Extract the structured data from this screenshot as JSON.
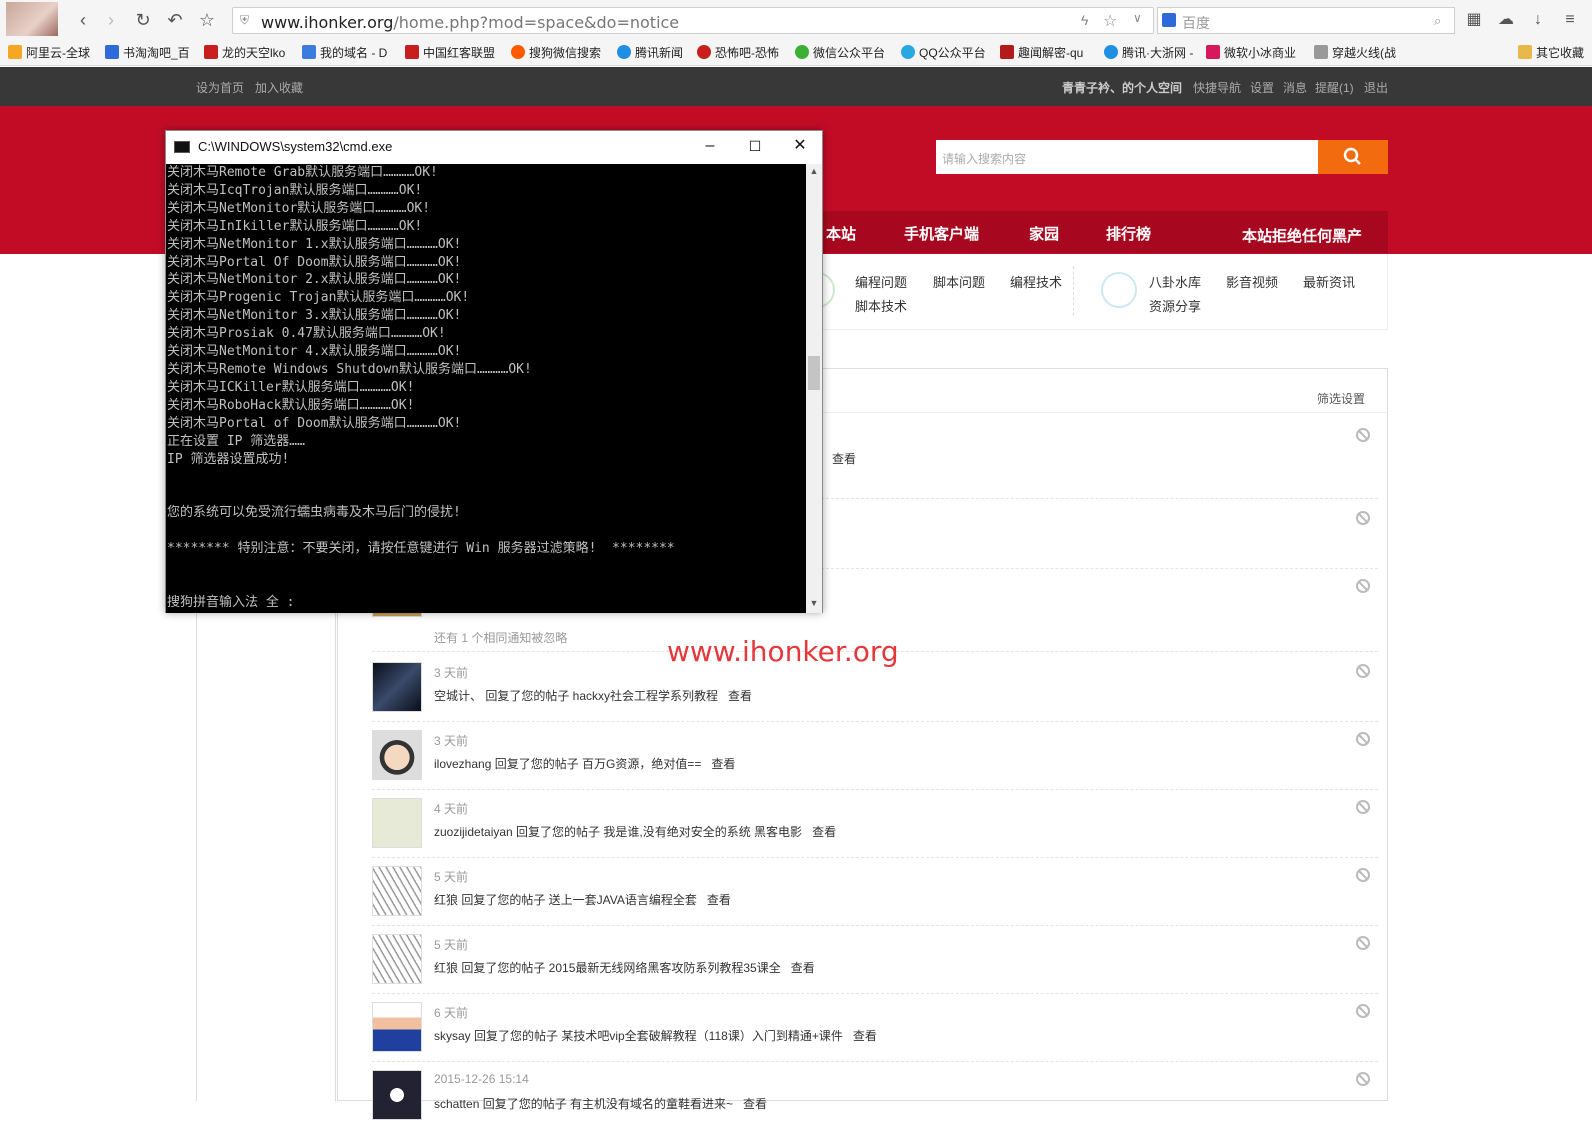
{
  "browser": {
    "url_host": "www.ihonker.org",
    "url_path": "/home.php?mod=space&do=notice",
    "search_placeholder": "百度",
    "bookmarks": [
      {
        "label": "阿里云-全球",
        "color": "#f5a623"
      },
      {
        "label": "书淘淘吧_百",
        "color": "#2f6bd8"
      },
      {
        "label": "龙的天空lko",
        "color": "#c81e1e"
      },
      {
        "label": "我的域名 - D",
        "color": "#3b7ddd"
      },
      {
        "label": "中国红客联盟",
        "color": "#c81e1e"
      },
      {
        "label": "搜狗微信搜索",
        "color": "#ff5a00"
      },
      {
        "label": "腾讯新闻",
        "color": "#1e8fe1"
      },
      {
        "label": "恐怖吧-恐怖",
        "color": "#c81e1e"
      },
      {
        "label": "微信公众平台",
        "color": "#3cb034"
      },
      {
        "label": "QQ公众平台",
        "color": "#29a7e1"
      },
      {
        "label": "趣闻解密-qu",
        "color": "#b31b1b"
      },
      {
        "label": "腾讯·大浙网 -",
        "color": "#1e8fe1"
      },
      {
        "label": "微软小冰商业",
        "color": "#d6195c"
      },
      {
        "label": "穿越火线(战",
        "color": "#999999"
      }
    ],
    "other_bookmarks": "其它收藏"
  },
  "site": {
    "top_left": [
      "设为首页",
      "加入收藏"
    ],
    "user_space": "青青子衿、的个人空间",
    "top_right": [
      "快捷导航",
      "设置",
      "消息",
      "提醒(1)",
      "退出"
    ],
    "search_placeholder": "请输入搜索内容",
    "nav": [
      "本站",
      "手机客户端",
      "家园",
      "排行榜"
    ],
    "slogan": "本站拒绝任何黑产",
    "categories_a": [
      "编程问题",
      "脚本问题",
      "编程技术",
      "脚本技术"
    ],
    "categories_b": [
      "八卦水库",
      "影音视频",
      "最新资讯",
      "资源分享"
    ],
    "filter_settings": "筛选设置",
    "watermark": "www.ihonker.org"
  },
  "notices": [
    {
      "time": "",
      "text": "",
      "view": "查看"
    },
    {
      "time": "",
      "text": "",
      "view": ""
    },
    {
      "time": "",
      "text": "还有 1 个相同通知被忽略",
      "view": ""
    },
    {
      "time": "3 天前",
      "text": "空城计、 回复了您的帖子 hackxy社会工程学系列教程",
      "view": "查看"
    },
    {
      "time": "3 天前",
      "text": "ilovezhang 回复了您的帖子 百万G资源，绝对值==",
      "view": "查看"
    },
    {
      "time": "4 天前",
      "text": "zuozijidetaiyan 回复了您的帖子 我是谁,没有绝对安全的系统 黑客电影",
      "view": "查看"
    },
    {
      "time": "5 天前",
      "text": "红狼 回复了您的帖子 送上一套JAVA语言编程全套",
      "view": "查看"
    },
    {
      "time": "5 天前",
      "text": "红狼 回复了您的帖子 2015最新无线网络黑客攻防系列教程35课全",
      "view": "查看"
    },
    {
      "time": "6 天前",
      "text": "skysay 回复了您的帖子 某技术吧vip全套破解教程（118课）入门到精通+课件",
      "view": "查看"
    },
    {
      "time": "2015-12-26 15:14",
      "text": "schatten 回复了您的帖子 有主机没有域名的童鞋看进来~",
      "view": "查看"
    }
  ],
  "cmd": {
    "title": "C:\\WINDOWS\\system32\\cmd.exe",
    "lines": [
      "关闭木马Remote Grab默认服务端口…………OK!",
      "关闭木马IcqTrojan默认服务端口…………OK!",
      "关闭木马NetMonitor默认服务端口…………OK!",
      "关闭木马InIkiller默认服务端口…………OK!",
      "关闭木马NetMonitor 1.x默认服务端口…………OK!",
      "关闭木马Portal Of Doom默认服务端口…………OK!",
      "关闭木马NetMonitor 2.x默认服务端口…………OK!",
      "关闭木马Progenic Trojan默认服务端口…………OK!",
      "关闭木马NetMonitor 3.x默认服务端口…………OK!",
      "关闭木马Prosiak 0.47默认服务端口…………OK!",
      "关闭木马NetMonitor 4.x默认服务端口…………OK!",
      "关闭木马Remote Windows Shutdown默认服务端口…………OK!",
      "关闭木马ICKiller默认服务端口…………OK!",
      "关闭木马RoboHack默认服务端口…………OK!",
      "关闭木马Portal of Doom默认服务端口…………OK!",
      "正在设置 IP 筛选器……",
      "IP 筛选器设置成功!",
      "",
      "",
      "您的系统可以免受流行蠕虫病毒及木马后门的侵扰!",
      "",
      "******** 特别注意：不要关闭，请按任意键进行 Win 服务器过滤策略!  ********",
      "",
      "",
      "搜狗拼音输入法 全 :"
    ]
  }
}
